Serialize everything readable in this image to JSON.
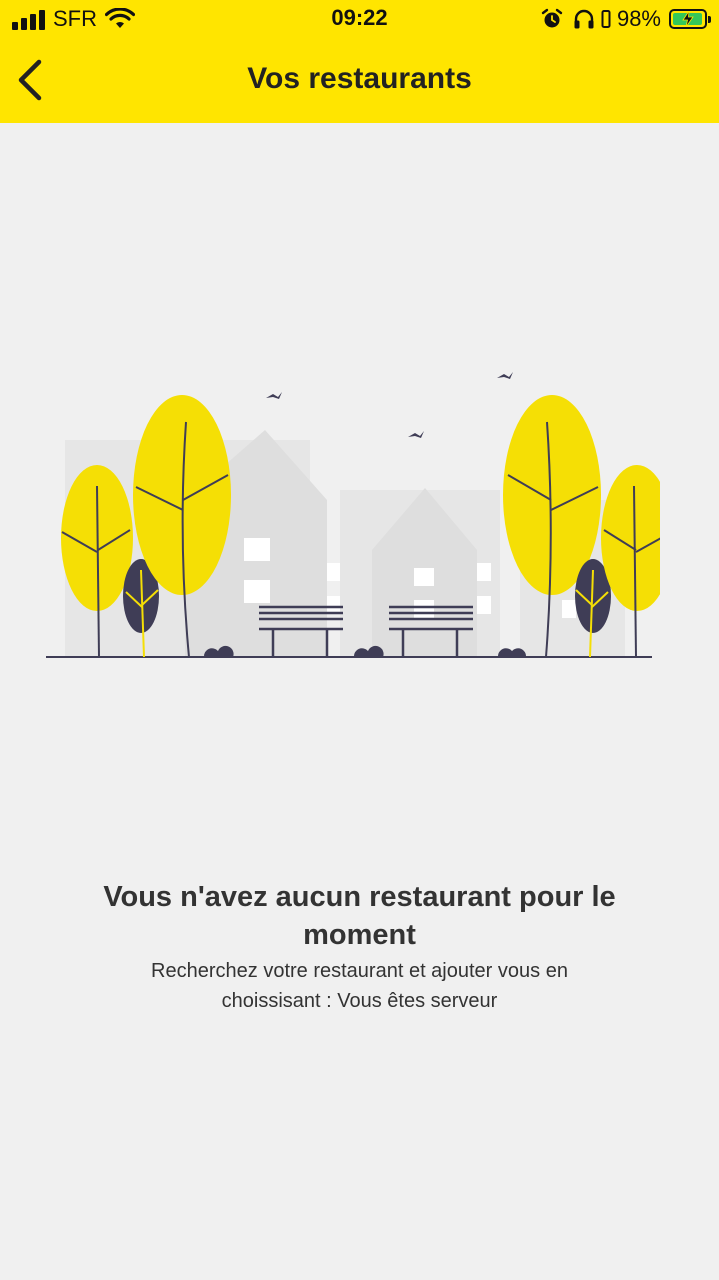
{
  "status_bar": {
    "carrier": "SFR",
    "time": "09:22",
    "battery_percent": "98%",
    "battery_level": 0.98,
    "charging": true,
    "icons": [
      "signal-icon",
      "wifi-icon",
      "alarm-icon",
      "headphones-icon",
      "battery-icon"
    ]
  },
  "nav": {
    "back_icon": "chevron-left-icon",
    "title": "Vos restaurants"
  },
  "empty_state": {
    "title": "Vous n'avez aucun restaurant pour le moment",
    "subtitle": "Recherchez votre restaurant et ajouter vous en choissisant : Vous êtes serveur"
  },
  "colors": {
    "accent": "#ffe500",
    "tree": "#f5df05",
    "dark": "#3f3d56",
    "background": "#f0f0f0",
    "building": "#e2e2e2"
  }
}
